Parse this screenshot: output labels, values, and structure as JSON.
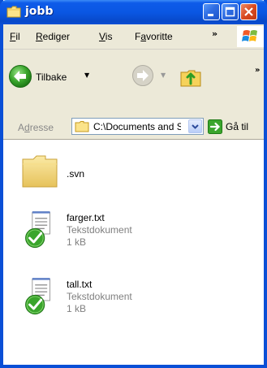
{
  "window": {
    "title": "jobb",
    "colors": {
      "titlebar": "#0a57e3",
      "close": "#d94a21",
      "chrome": "#ece9d8"
    }
  },
  "menubar": {
    "items": [
      {
        "underline": "F",
        "rest": "il"
      },
      {
        "underline": "R",
        "rest": "ediger"
      },
      {
        "underline": "V",
        "rest": "is"
      },
      {
        "pre": "F",
        "underline": "a",
        "rest": "voritte"
      }
    ],
    "overflow": "»"
  },
  "toolbar": {
    "back_label": "Tilbake",
    "back_arrow": "▼",
    "forward_arrow": "▼",
    "overflow": "»"
  },
  "addressbar": {
    "label_underline": "d",
    "label_pre": "A",
    "label_rest": "resse",
    "value": "C:\\Documents and Settings",
    "go_label": "Gå til"
  },
  "items": [
    {
      "name": ".svn",
      "type": "",
      "size": "",
      "icon": "folder-icon"
    },
    {
      "name": "farger.txt",
      "type": "Tekstdokument",
      "size": "1 kB",
      "icon": "text-document-icon"
    },
    {
      "name": "tall.txt",
      "type": "Tekstdokument",
      "size": "1 kB",
      "icon": "text-document-icon"
    }
  ]
}
